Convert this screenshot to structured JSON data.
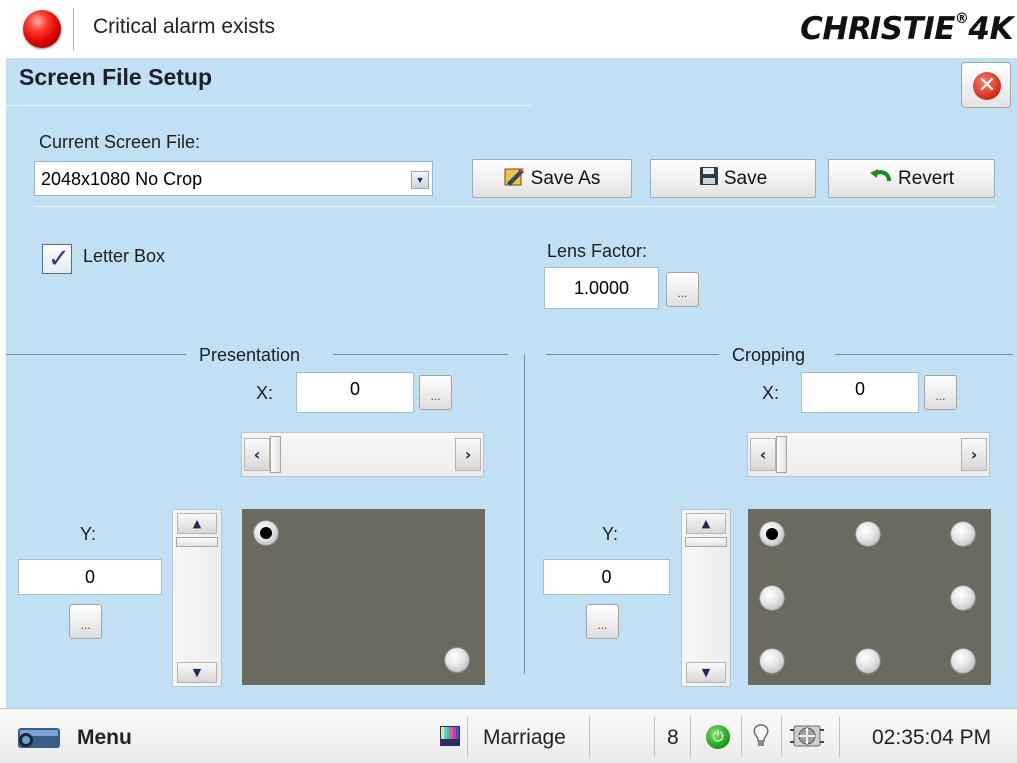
{
  "header": {
    "alarm_text": "Critical alarm exists",
    "brand": "CHRISTIE 4K",
    "alarm_color": "#e00000"
  },
  "page": {
    "title": "Screen File Setup",
    "close_icon": "close-icon"
  },
  "screen_file": {
    "label": "Current Screen File:",
    "selected": "2048x1080 No Crop"
  },
  "buttons": {
    "save_as": "Save As",
    "save": "Save",
    "revert": "Revert"
  },
  "letter_box": {
    "label": "Letter Box",
    "checked": true
  },
  "lens_factor": {
    "label": "Lens Factor:",
    "value": "1.0000"
  },
  "presentation": {
    "title": "Presentation",
    "x_label": "X:",
    "x_value": "0",
    "y_label": "Y:",
    "y_value": "0",
    "ellipsis": "...",
    "anchors_selected": "top-left"
  },
  "cropping": {
    "title": "Cropping",
    "x_label": "X:",
    "x_value": "0",
    "y_label": "Y:",
    "y_value": "0",
    "ellipsis": "...",
    "anchors_selected": "top-left"
  },
  "statusbar": {
    "menu": "Menu",
    "channel": "Marriage",
    "count": "8",
    "time": "02:35:04 PM"
  },
  "colors": {
    "panel_bg": "#c2e0f4",
    "anchor_bg": "#6b6a5f"
  }
}
